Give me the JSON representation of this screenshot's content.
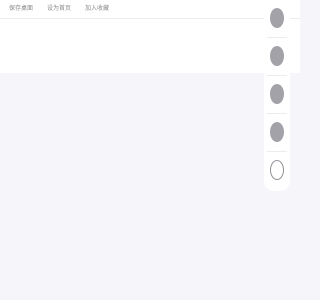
{
  "top_links": [
    {
      "label": "保存桌面"
    },
    {
      "label": "设为首页"
    },
    {
      "label": "加入收藏"
    }
  ],
  "right_rail": {
    "items": [
      {
        "icon": "circle-avatar-1-icon",
        "style": "filled"
      },
      {
        "icon": "circle-avatar-2-icon",
        "style": "filled"
      },
      {
        "icon": "circle-avatar-3-icon",
        "style": "filled"
      },
      {
        "icon": "circle-avatar-4-icon",
        "style": "filled"
      },
      {
        "icon": "circle-outline-icon",
        "style": "outline"
      }
    ]
  },
  "colors": {
    "page_background": "#f6f6fa",
    "panel_background": "#ffffff",
    "link_text": "#8a8a8a",
    "icon_fill": "#a2a2a8"
  }
}
